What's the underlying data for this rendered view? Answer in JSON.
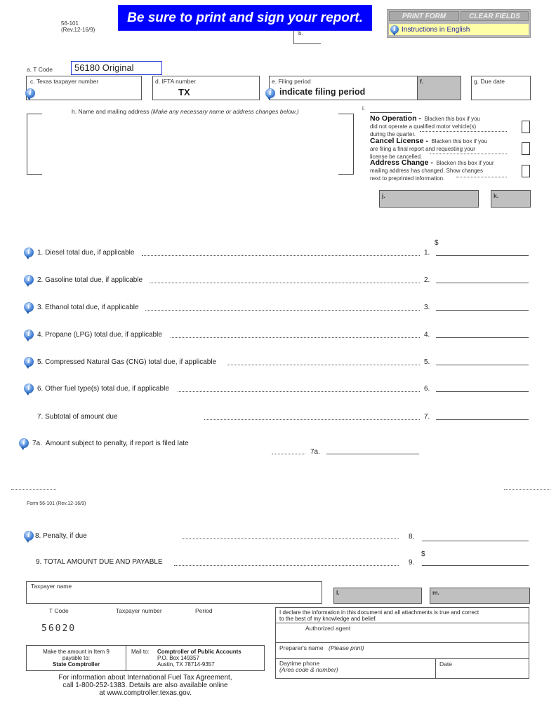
{
  "header": {
    "form_number": "56-101",
    "form_revision": "(Rev.12-16/9)",
    "banner_text": "Be sure to print and sign your report.",
    "field_b_label": "b.",
    "buttons": {
      "print_form": "PRINT FORM",
      "clear_fields": "CLEAR FIELDS"
    },
    "instructions_link": "Instructions in English",
    "banner_color": "#0000ff",
    "instructions_bg": "#ffffa8"
  },
  "fields": {
    "t_code": {
      "label": "a. T Code",
      "value": "56180  Original"
    },
    "taxpayer_number": {
      "label": "c. Texas taxpayer number",
      "value": ""
    },
    "ifta_number": {
      "label": "d. IFTA number",
      "value": "TX"
    },
    "filing_period": {
      "label": "e. Filing period",
      "value": "indicate filing period"
    },
    "field_f": {
      "label": "f."
    },
    "due_date": {
      "label": "g. Due date",
      "value": ""
    },
    "name_address": {
      "label": "h. Name and mailing address",
      "note": "(Make any necessary name or address changes below.)"
    },
    "field_i_label": "i.",
    "field_j": {
      "label": "j."
    },
    "field_k": {
      "label": "k."
    }
  },
  "checkboxes": [
    {
      "title": "No Operation -",
      "desc1": "Blacken this box if you",
      "desc2": "did not operate a qualified motor vehicle(s)",
      "desc3": "during the quarter.",
      "checked": false
    },
    {
      "title": "Cancel License -",
      "desc1": "Blacken this box if you",
      "desc2": "are filing a final report and requesting your",
      "desc3": "license be cancelled.",
      "checked": false
    },
    {
      "title": "Address Change -",
      "desc1": "Blacken this box if your",
      "desc2": "mailing address has changed. Show changes",
      "desc3": "next to preprinted information.",
      "checked": false
    }
  ],
  "lines": {
    "currency_symbol": "$",
    "items": [
      {
        "label": "1. Diesel total due, if applicable",
        "number": "1.",
        "value": ""
      },
      {
        "label": "2. Gasoline total due, if applicable",
        "number": "2.",
        "value": ""
      },
      {
        "label": "3. Ethanol total due, if applicable",
        "number": "3.",
        "value": ""
      },
      {
        "label": "4. Propane (LPG) total due, if applicable",
        "number": "4.",
        "value": ""
      },
      {
        "label": "5. Compressed Natural Gas (CNG) total due, if applicable",
        "number": "5.",
        "value": ""
      },
      {
        "label": "6. Other fuel type(s) total due, if applicable",
        "number": "6.",
        "value": ""
      }
    ],
    "subtotal": {
      "label": "7. Subtotal of amount due",
      "number": "7.",
      "value": ""
    },
    "penalty_amount": {
      "prefix": "7a.",
      "label": "Amount subject to penalty, if report is filed late",
      "number": "7a.",
      "value": ""
    }
  },
  "stub": {
    "form_ref": "Form 56-101 (Rev.12-16/9)",
    "penalty": {
      "label": "8.  Penalty, if due",
      "number": "8.",
      "value": ""
    },
    "total": {
      "label": "9. TOTAL AMOUNT DUE AND PAYABLE",
      "number": "9.",
      "currency": "$",
      "value": ""
    },
    "taxpayer_name_label": "Taxpayer name",
    "field_l": "l.",
    "field_m": "m.",
    "col_t_code": "T Code",
    "col_taxpayer_number": "Taxpayer number",
    "col_period": "Period",
    "t_code_value": "56020",
    "payable_1": "Make the amount in Item 9",
    "payable_2": "payable to:",
    "payable_3": "State Comptroller",
    "mail_to_label": "Mail to:",
    "mail_1": "Comptroller of Public Accounts",
    "mail_2": "P.O. Box 149357",
    "mail_3": "Austin, TX  78714-9357",
    "declare_1": "I declare the information in this document and all attachments is true and correct",
    "declare_2": "to the best of my knowledge and belief.",
    "authorized_agent": "Authorized agent",
    "preparer_label": "Preparer's name",
    "preparer_note": "(Please print)",
    "phone_label": "Daytime phone",
    "phone_note": "(Area code & number)",
    "date_label": "Date",
    "info_1": "For information about International Fuel Tax Agreement,",
    "info_2": "call 1-800-252-1383. Details are also available online",
    "info_3": "at www.comptroller.texas.gov."
  }
}
